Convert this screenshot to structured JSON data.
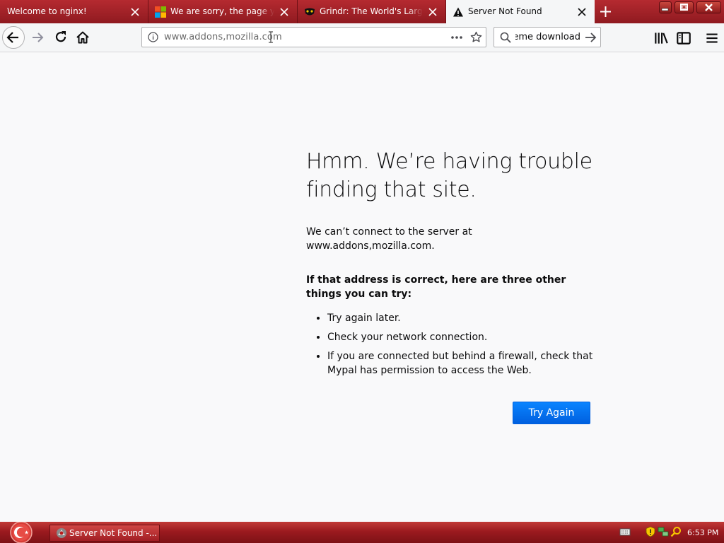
{
  "tabs": [
    {
      "title": "Welcome to nginx!",
      "active": false
    },
    {
      "title": "We are sorry, the page you requested",
      "active": false
    },
    {
      "title": "Grindr: The World's Largest Social",
      "active": false
    },
    {
      "title": "Server Not Found",
      "active": true
    }
  ],
  "navbar": {
    "url": "www.addons,mozilla.com",
    "search_value": "theme download"
  },
  "error_page": {
    "title": "Hmm. We’re having trouble finding that site.",
    "short_desc": "We can’t connect to the server at www.addons,mozilla.com.",
    "long_title": "If that address is correct, here are three other things you can try:",
    "suggestions": [
      "Try again later.",
      "Check your network connection.",
      "If you are connected but behind a firewall, check that Mypal has permission to access the Web."
    ],
    "button_label": "Try Again"
  },
  "taskbar": {
    "task_label": "Server Not Found -...",
    "clock": "6:53 PM"
  },
  "colors": {
    "tabbar": "#9e1c24",
    "accent_button": "#0a84ff",
    "page_background": "#f9f9fa"
  }
}
